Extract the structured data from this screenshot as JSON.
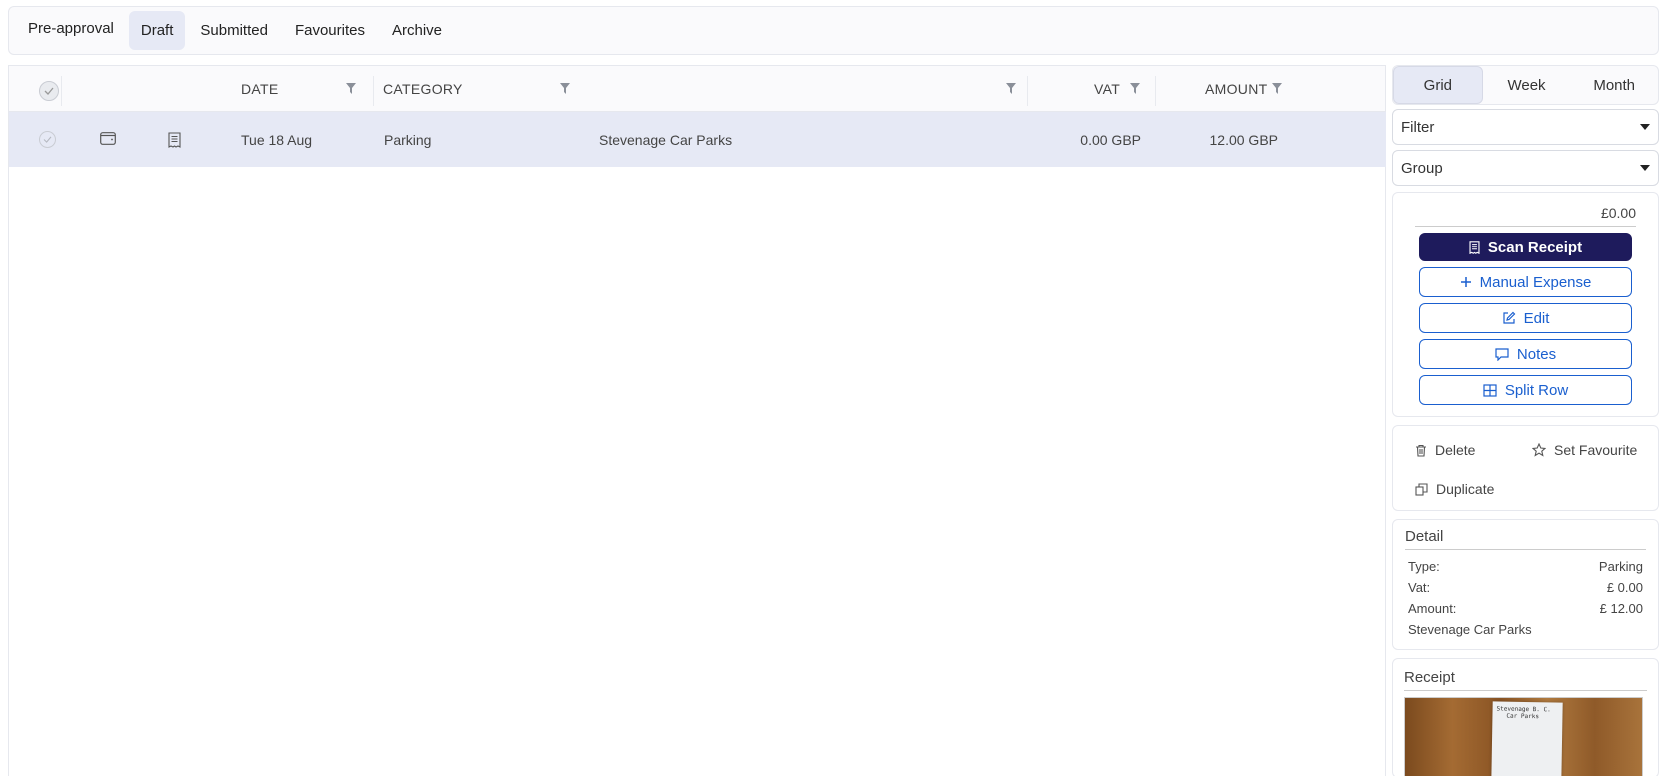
{
  "top_tabs": [
    {
      "label": "Pre-approval",
      "active": false
    },
    {
      "label": "Draft",
      "active": true
    },
    {
      "label": "Submitted",
      "active": false
    },
    {
      "label": "Favourites",
      "active": false
    },
    {
      "label": "Archive",
      "active": false
    }
  ],
  "table": {
    "columns": {
      "date": "DATE",
      "category": "CATEGORY",
      "vat": "VAT",
      "amount": "AMOUNT"
    },
    "rows": [
      {
        "date": "Tue 18 Aug",
        "category": "Parking",
        "description": "Stevenage Car Parks",
        "vat": "0.00 GBP",
        "amount": "12.00 GBP",
        "selected": true
      }
    ]
  },
  "view_tabs": [
    {
      "label": "Grid",
      "active": true
    },
    {
      "label": "Week",
      "active": false
    },
    {
      "label": "Month",
      "active": false
    }
  ],
  "filter": {
    "label": "Filter"
  },
  "group": {
    "label": "Group"
  },
  "actions": {
    "total": "£0.00",
    "scan_receipt": "Scan Receipt",
    "manual_expense": "Manual Expense",
    "edit": "Edit",
    "notes": "Notes",
    "split_row": "Split Row"
  },
  "row_actions": {
    "delete": "Delete",
    "set_favourite": "Set Favourite",
    "duplicate": "Duplicate"
  },
  "detail": {
    "title": "Detail",
    "type_label": "Type:",
    "type_value": "Parking",
    "vat_label": "Vat:",
    "vat_value": "£ 0.00",
    "amount_label": "Amount:",
    "amount_value": "£ 12.00",
    "description": "Stevenage Car Parks"
  },
  "receipt": {
    "title": "Receipt",
    "line1": "Stevenage B. C.",
    "line2": "Car Parks"
  },
  "colors": {
    "primary": "#1e1b5c",
    "link": "#1a5fcf",
    "selected_row": "#e6e9f5"
  }
}
